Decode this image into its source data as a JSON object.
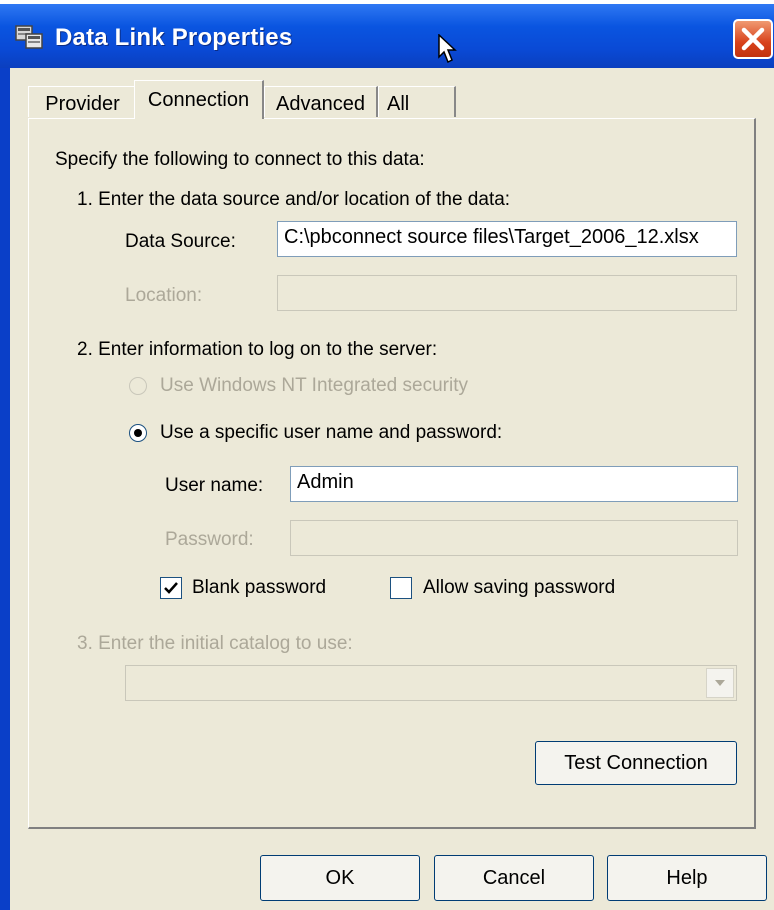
{
  "window": {
    "title": "Data Link Properties"
  },
  "tabs": [
    {
      "label": "Provider",
      "active": false
    },
    {
      "label": "Connection",
      "active": true
    },
    {
      "label": "Advanced",
      "active": false
    },
    {
      "label": "All",
      "active": false
    }
  ],
  "intro": "Specify the following to connect to this data:",
  "step1": {
    "heading": "1. Enter the data source and/or location of the data:",
    "data_source_label": "Data Source:",
    "data_source_value": "C:\\pbconnect source files\\Target_2006_12.xlsx",
    "location_label": "Location:",
    "location_value": ""
  },
  "step2": {
    "heading": "2. Enter information to log on to the server:",
    "option_nt": "Use Windows NT Integrated security",
    "option_specific": "Use a specific user name and password:",
    "selected": "specific",
    "username_label": "User name:",
    "username_value": "Admin",
    "password_label": "Password:",
    "password_value": "",
    "blank_password_label": "Blank password",
    "blank_password_checked": true,
    "allow_saving_label": "Allow saving password",
    "allow_saving_checked": false
  },
  "step3": {
    "heading": "3. Enter the initial catalog to use:",
    "catalog_value": ""
  },
  "buttons": {
    "test_connection": "Test Connection",
    "ok": "OK",
    "cancel": "Cancel",
    "help": "Help"
  },
  "icons": {
    "app": "data-link-icon",
    "close": "close-icon",
    "cursor": "mouse-pointer-icon",
    "combo_arrow": "chevron-down-icon",
    "check": "checkmark-icon"
  },
  "colors": {
    "titlebar": "#0a55e0",
    "dialog_bg": "#ece9d8",
    "close_button": "#d8421c",
    "disabled_text": "#aca899"
  }
}
